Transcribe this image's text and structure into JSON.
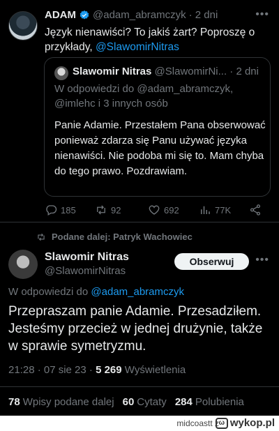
{
  "tweet1": {
    "name": "ADAM",
    "handle": "@adam_abramczyk",
    "time": "· 2 dni",
    "text_before": "Język nienawiści? To jakiś żart? Poproszę o przykłady, ",
    "mention": "@SlawomirNitras"
  },
  "quote": {
    "name": "Slawomir Nitras",
    "handle": "@SlawomirNi...",
    "time": "· 2 dni",
    "reply_prefix": "W odpowiedzi do ",
    "reply_users": "@adam_abramczyk, @imlehc i 3 innych osób",
    "text": "Panie Adamie. Przestałem Pana obserwować ponieważ zdarza się Panu używać języka nienawiści. Nie podoba mi się to. Mam chyba do tego prawo. Pozdrawiam."
  },
  "actions": {
    "replies": "185",
    "retweets": "92",
    "likes": "692",
    "views": "77K"
  },
  "retweet_line": "Podane dalej: Patryk Wachowiec",
  "tweet2": {
    "name": "Slawomir Nitras",
    "handle": "@SlawomirNitras",
    "follow_label": "Obserwuj",
    "reply_prefix": "W odpowiedzi do ",
    "reply_user": "@adam_abramczyk",
    "text": "Przepraszam panie Adamie. Przesadziłem. Jesteśmy przecież w jednej drużynie, także w sprawie symetryzmu.",
    "time": "21:28 · 07 sie 23 · ",
    "views_count": "5 269",
    "views_label": " Wyświetlenia"
  },
  "stats": {
    "retweets_count": "78",
    "retweets_label": "Wpisy podane dalej",
    "quotes_count": "60",
    "quotes_label": "Cytaty",
    "likes_count": "284",
    "likes_label": "Polubienia"
  },
  "watermark": {
    "user": "midcoastt z",
    "brand": "wykop.pl"
  },
  "colors": {
    "background": "#000000",
    "accent": "#1d9bf0",
    "muted": "#71767b",
    "text": "#e7e9ea"
  }
}
